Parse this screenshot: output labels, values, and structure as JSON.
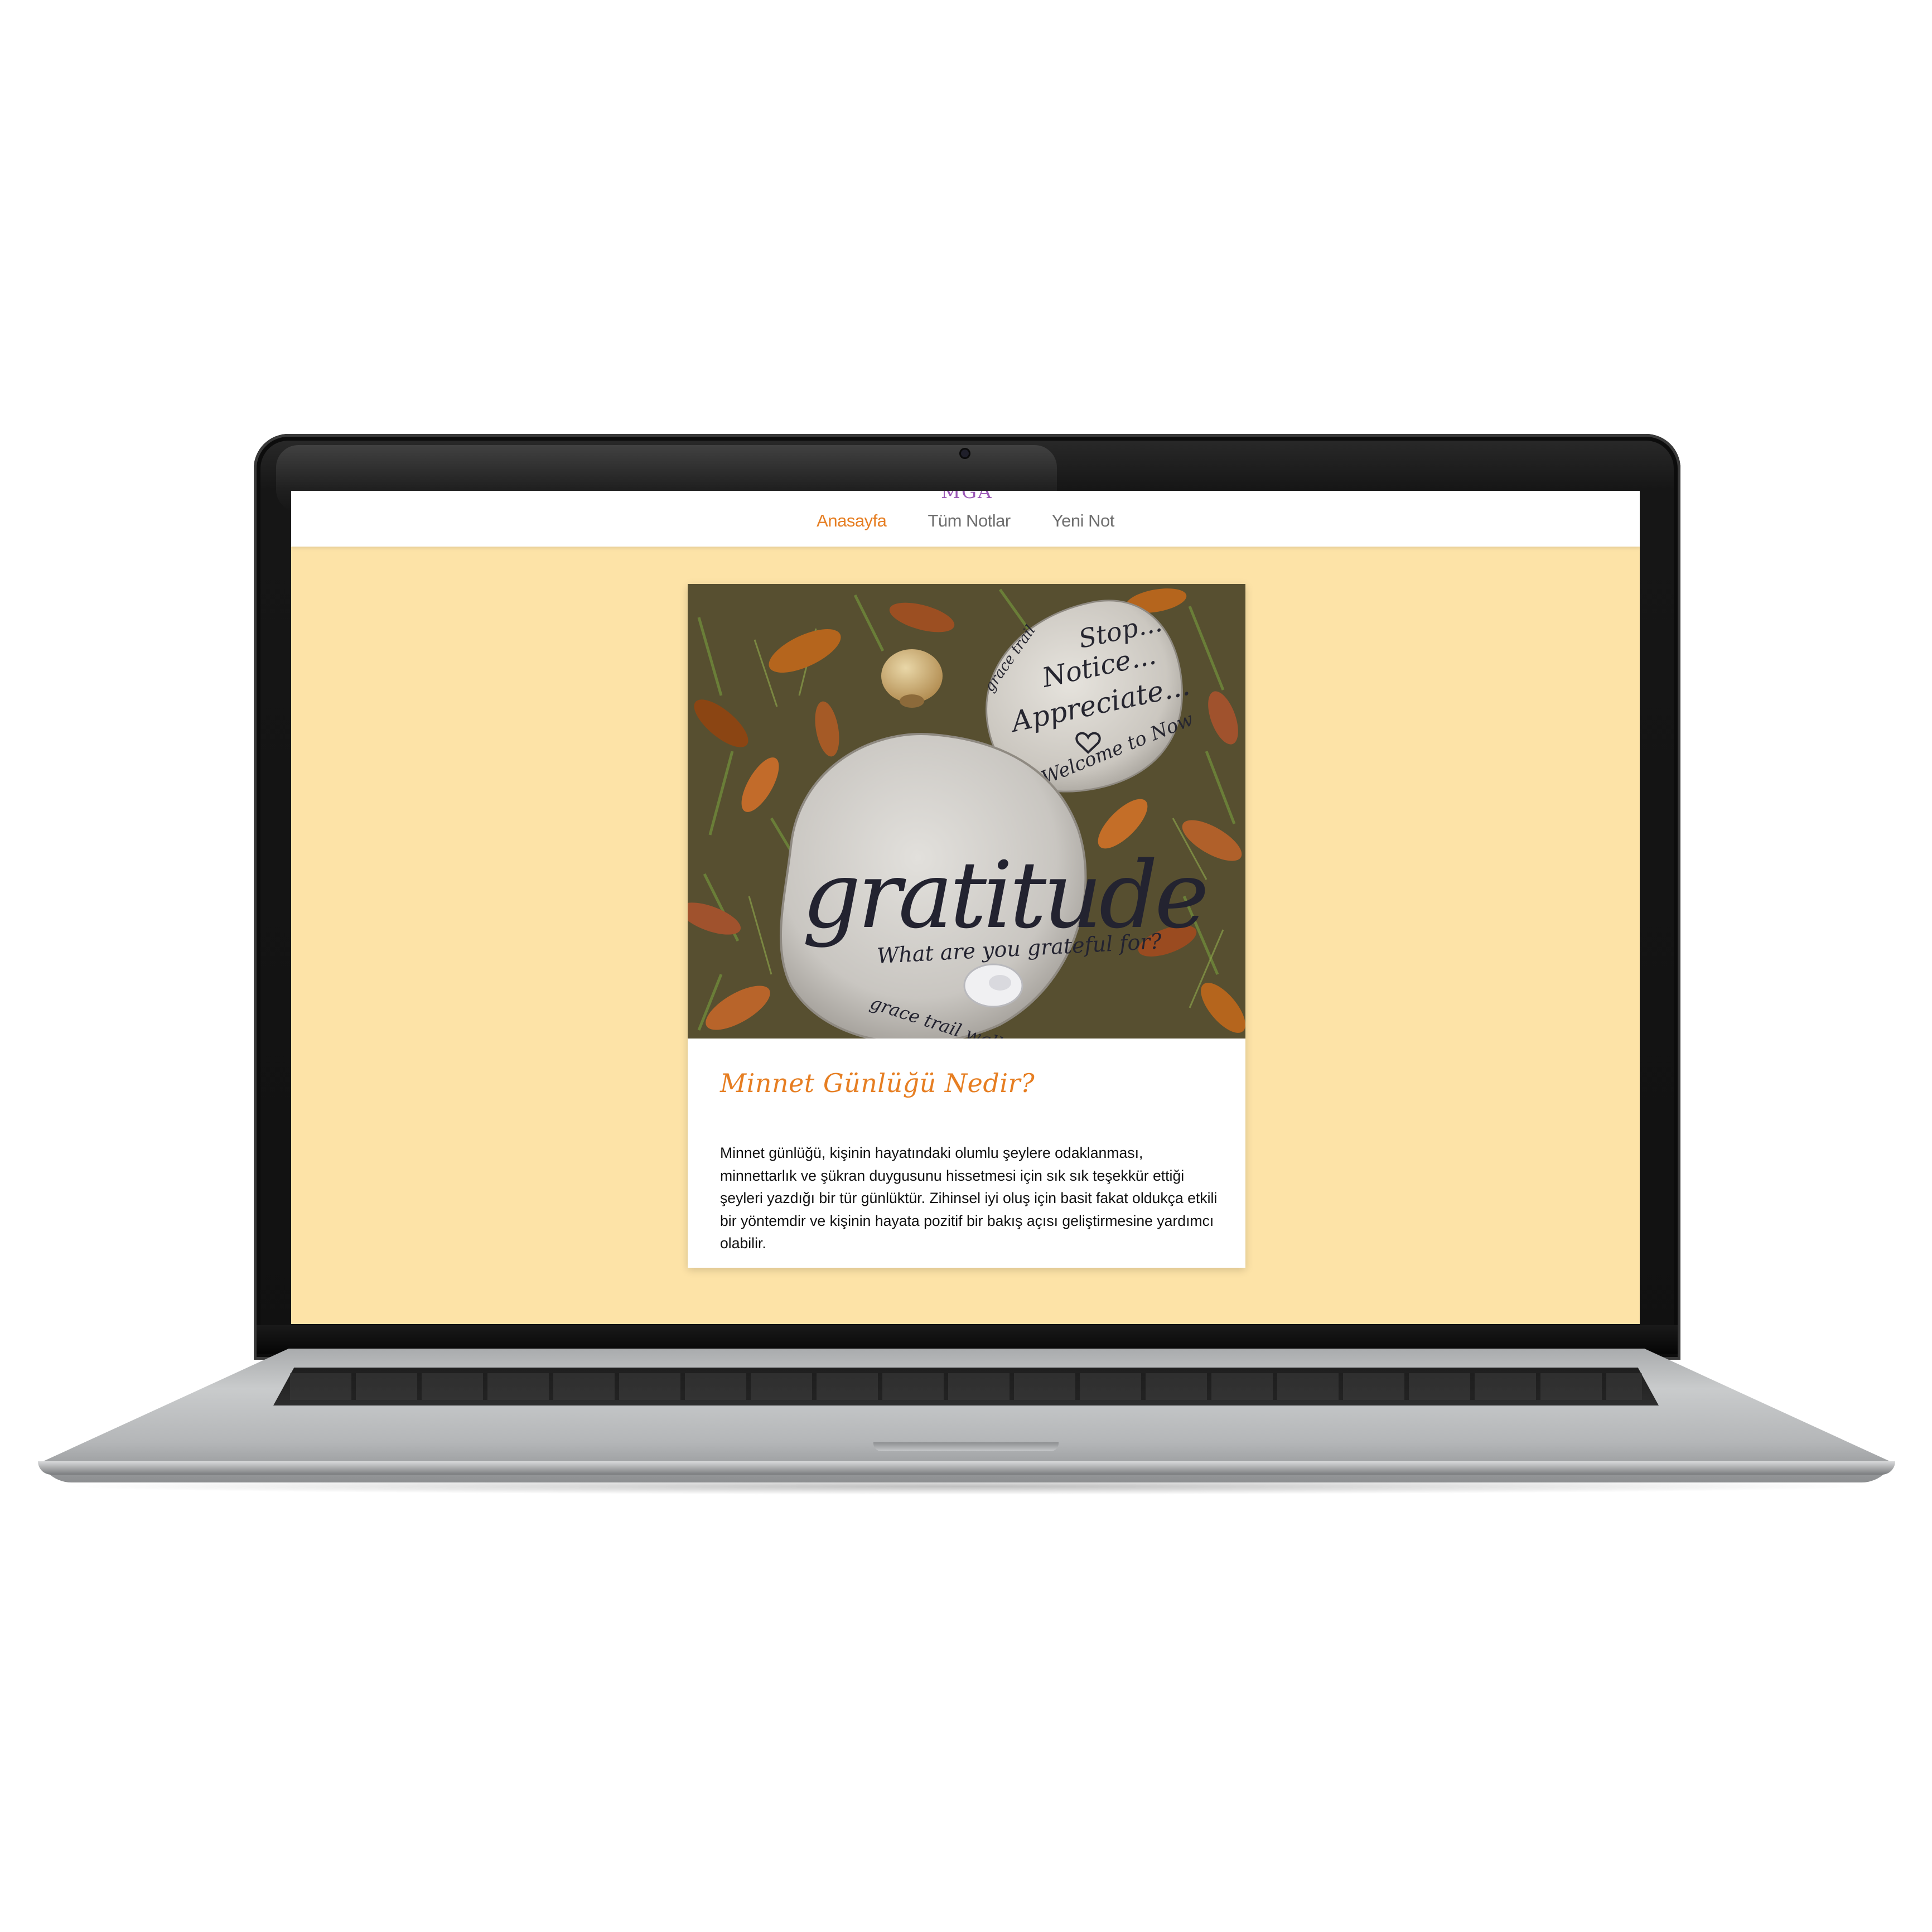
{
  "site": {
    "brand": "MGA"
  },
  "nav": {
    "items": [
      {
        "label": "Anasayfa",
        "active": true
      },
      {
        "label": "Tüm Notlar",
        "active": false
      },
      {
        "label": "Yeni Not",
        "active": false
      }
    ]
  },
  "card": {
    "title": "Minnet Günlüğü Nedir?",
    "body": "Minnet günlüğü, kişinin hayatındaki olumlu şeylere odaklanması, minnettarlık ve şükran duygusunu hissetmesi için sık sık teşekkür ettiği şeyleri yazdığı bir tür günlüktür. Zihinsel iyi oluş için basit fakat oldukça etkili bir yöntemdir ve kişinin hayata pozitif bir bakış açısı geliştirmesine yardımcı olabilir.",
    "image": {
      "stone_large_text": "gratitude",
      "stone_large_subtext": "What are you grateful for?",
      "stone_large_footer": "grace trail walk...",
      "stone_small_lines": [
        "Stop...",
        "Notice...",
        "Appreciate..."
      ],
      "stone_small_footer": "Welcome to Now",
      "stone_small_side": "grace trail"
    }
  },
  "colors": {
    "accent": "#e67e22",
    "page_background": "#fde3a7",
    "nav_text": "#6e6e6e",
    "card_background": "#ffffff"
  }
}
